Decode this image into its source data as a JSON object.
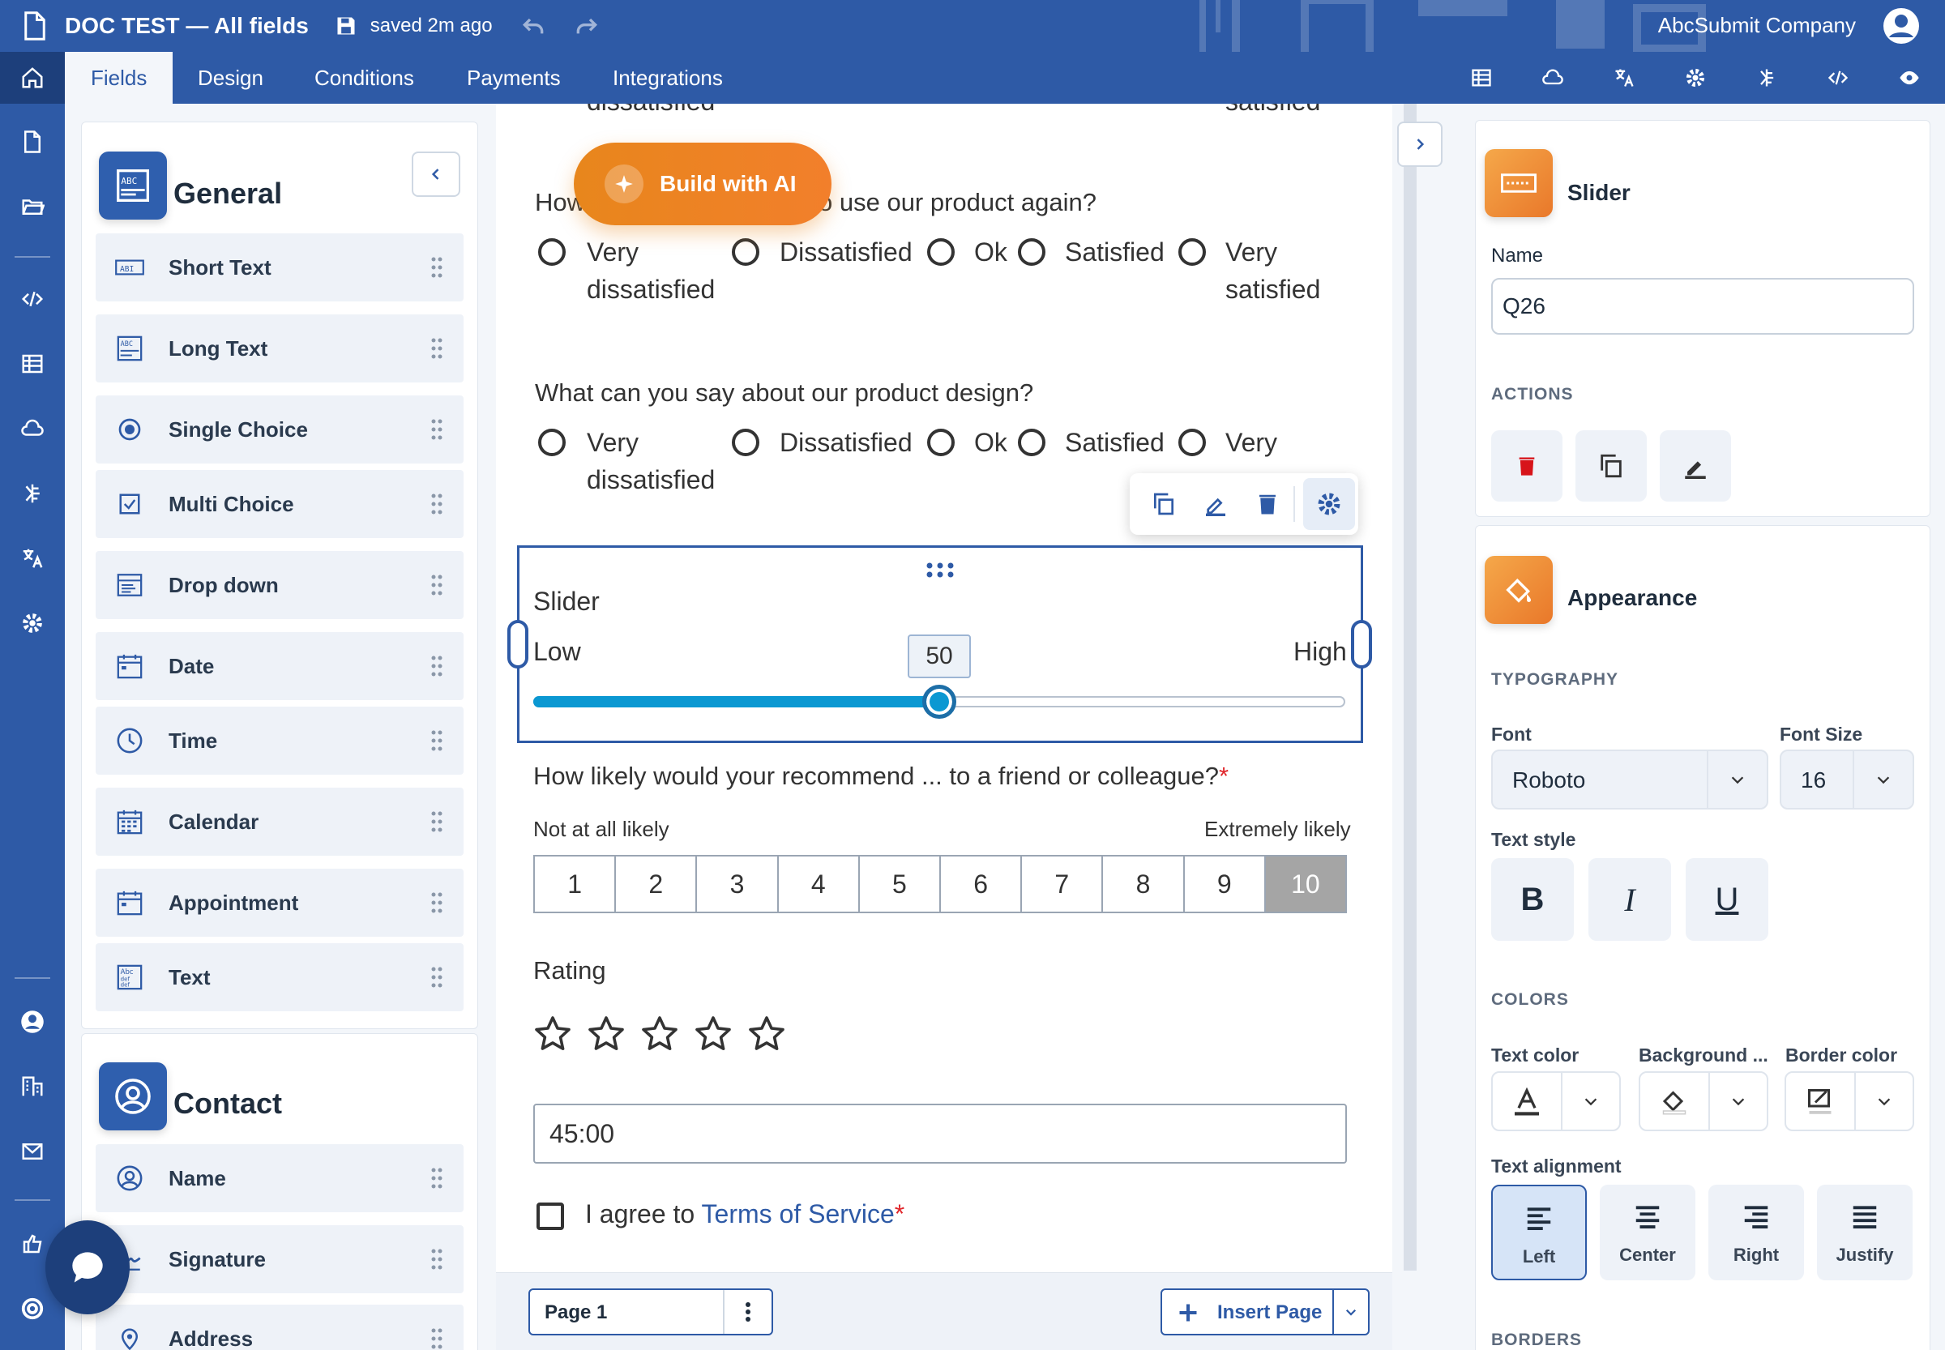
{
  "header": {
    "title": "DOC TEST — All fields",
    "saved": "saved 2m ago",
    "company": "AbcSubmit Company"
  },
  "nav": {
    "tabs": [
      "Fields",
      "Design",
      "Conditions",
      "Payments",
      "Integrations"
    ],
    "active_tab": "Fields"
  },
  "left_panel": {
    "general_title": "General",
    "fields": [
      {
        "label": "Short Text",
        "icon": "short-text-icon"
      },
      {
        "label": "Long Text",
        "icon": "long-text-icon"
      },
      {
        "label": "Single Choice",
        "icon": "radio-icon"
      },
      {
        "label": "Multi Choice",
        "icon": "checkbox-icon"
      },
      {
        "label": "Drop down",
        "icon": "dropdown-icon"
      },
      {
        "label": "Date",
        "icon": "date-icon"
      },
      {
        "label": "Time",
        "icon": "clock-icon"
      },
      {
        "label": "Calendar",
        "icon": "calendar-icon"
      },
      {
        "label": "Appointment",
        "icon": "appointment-icon"
      },
      {
        "label": "Text",
        "icon": "text-icon"
      }
    ],
    "contact_title": "Contact",
    "contact_fields": [
      {
        "label": "Name",
        "icon": "person-icon"
      },
      {
        "label": "Signature",
        "icon": "signature-icon"
      },
      {
        "label": "Address",
        "icon": "location-icon"
      }
    ]
  },
  "canvas": {
    "ai_button": "Build with AI",
    "q1": {
      "prefix": "How",
      "suffix": "o use our product again?",
      "options": [
        "Very dissatisfied",
        "Dissatisfied",
        "Ok",
        "Satisfied",
        "Very satisfied"
      ]
    },
    "top_cut": {
      "left": "dissatisfied",
      "right": "satisfied"
    },
    "q2": {
      "text": "What can you say about our product design?",
      "options": [
        "Very dissatisfied",
        "Dissatisfied",
        "Ok",
        "Satisfied",
        "Very"
      ]
    },
    "slider": {
      "title": "Slider",
      "low": "Low",
      "high": "High",
      "value": "50",
      "min": 0,
      "max": 100
    },
    "nps": {
      "question": "How likely would your recommend ... to a friend or colleague?",
      "required_mark": "*",
      "left_label": "Not at all likely",
      "right_label": "Extremely likely",
      "scale": [
        "1",
        "2",
        "3",
        "4",
        "5",
        "6",
        "7",
        "8",
        "9",
        "10"
      ],
      "selected": "10"
    },
    "rating": {
      "label": "Rating",
      "stars": 5,
      "value": 0
    },
    "time_value": "45:00",
    "agree": {
      "text": "I agree to ",
      "link": "Terms of Service",
      "required_mark": "*"
    },
    "page_label": "Page 1",
    "insert_page": "Insert Page"
  },
  "right_panel": {
    "element_title": "Slider",
    "name_label": "Name",
    "name_value": "Q26",
    "actions_label": "ACTIONS",
    "appearance_title": "Appearance",
    "typography_label": "TYPOGRAPHY",
    "font_label": "Font",
    "font_value": "Roboto",
    "font_size_label": "Font Size",
    "font_size_value": "16",
    "text_style_label": "Text style",
    "bold": "B",
    "italic": "I",
    "underline": "U",
    "colors_label": "COLORS",
    "text_color_label": "Text color",
    "background_label": "Background ...",
    "border_color_label": "Border color",
    "text_alignment_label": "Text alignment",
    "alignments": [
      "Left",
      "Center",
      "Right",
      "Justify"
    ],
    "selected_alignment": "Left",
    "borders_label": "BORDERS"
  },
  "colors": {
    "brand": "#2e5aa6",
    "accent": "#0b98d2",
    "orange": "#e8861c",
    "required": "#e0262b"
  }
}
